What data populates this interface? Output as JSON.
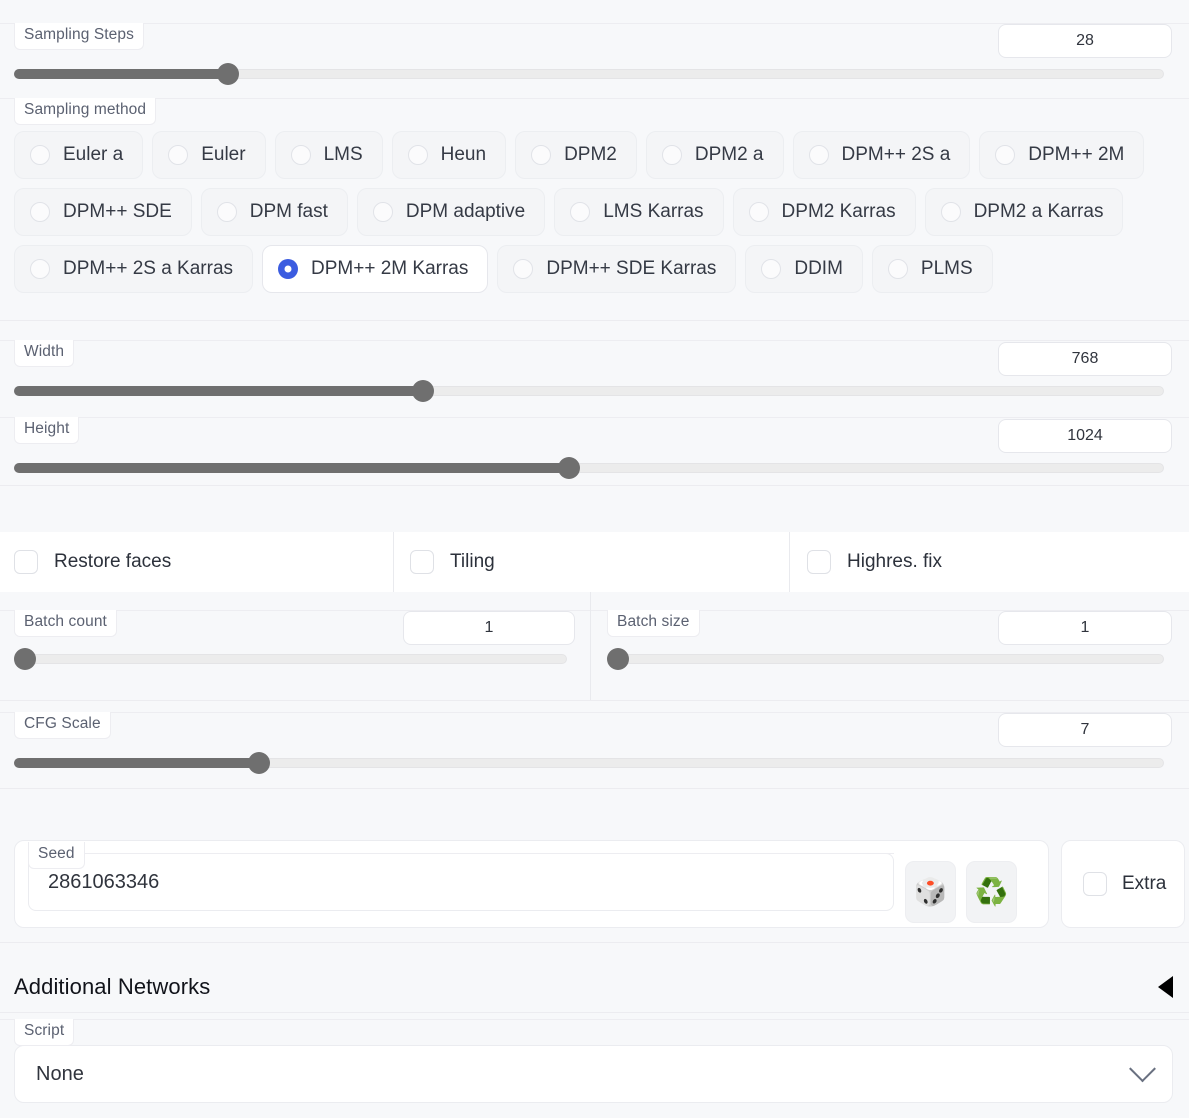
{
  "sampling_steps": {
    "label": "Sampling Steps",
    "value": "28",
    "fill_percent": 18.6
  },
  "sampling_method": {
    "label": "Sampling method",
    "selected": "DPM++ 2M Karras",
    "options": [
      "Euler a",
      "Euler",
      "LMS",
      "Heun",
      "DPM2",
      "DPM2 a",
      "DPM++ 2S a",
      "DPM++ 2M",
      "DPM++ SDE",
      "DPM fast",
      "DPM adaptive",
      "LMS Karras",
      "DPM2 Karras",
      "DPM2 a Karras",
      "DPM++ 2S a Karras",
      "DPM++ 2M Karras",
      "DPM++ SDE Karras",
      "DDIM",
      "PLMS"
    ]
  },
  "width": {
    "label": "Width",
    "value": "768",
    "fill_percent": 35.6
  },
  "height": {
    "label": "Height",
    "value": "1024",
    "fill_percent": 48.3
  },
  "toggles": [
    {
      "label": "Restore faces",
      "checked": false
    },
    {
      "label": "Tiling",
      "checked": false
    },
    {
      "label": "Highres. fix",
      "checked": false
    }
  ],
  "batch_count": {
    "label": "Batch count",
    "value": "1",
    "fill_percent": 0
  },
  "batch_size": {
    "label": "Batch size",
    "value": "1",
    "fill_percent": 0
  },
  "cfg_scale": {
    "label": "CFG Scale",
    "value": "7",
    "fill_percent": 21.3
  },
  "seed": {
    "label": "Seed",
    "value": "2861063346",
    "random_icon": "dice-icon",
    "random_glyph": "🎲",
    "reuse_icon": "recycle-icon",
    "reuse_glyph": "♻️",
    "extra_label": "Extra",
    "extra_checked": false
  },
  "additional_networks": {
    "title": "Additional Networks",
    "collapse_icon": "triangle-left-icon",
    "expanded": false
  },
  "script": {
    "label": "Script",
    "value": "None",
    "chevron_icon": "chevron-down-icon",
    "options": [
      "None"
    ]
  },
  "colors": {
    "accent": "#3b5ce0",
    "slider_fill": "#6f6f6f",
    "panel_bg": "#f7f8fa",
    "border": "#ebecf0"
  }
}
